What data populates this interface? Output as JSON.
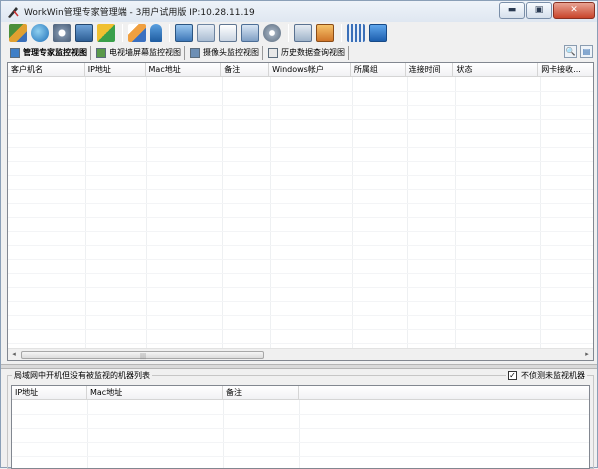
{
  "window": {
    "title": "WorkWin管理专家管理端 - 3用户试用版 IP:10.28.11.19",
    "controls": {
      "minimize": "▬",
      "maximize": "▣",
      "close": "✕"
    }
  },
  "toolbar": {
    "icons": [
      "books-icon",
      "globe-icon",
      "settings-gear-icon",
      "monitor-user-icon",
      "puzzle-icon",
      "edit-pencil-icon",
      "pin-icon",
      "computer-icon",
      "mail-icon",
      "document-edit-icon",
      "windows-icon",
      "disk-icon",
      "notepad-icon",
      "transfer-icon",
      "keyboard-icon",
      "info-icon"
    ]
  },
  "tabs": [
    {
      "label": "管理专家监控视图",
      "active": true
    },
    {
      "label": "电视墙屏幕监控视图",
      "active": false
    },
    {
      "label": "摄像头监控视图",
      "active": false
    },
    {
      "label": "历史数据查询视图",
      "active": false
    }
  ],
  "upper_table": {
    "columns": [
      "客户机名",
      "IP地址",
      "Mac地址",
      "备注",
      "Windows帐户",
      "所属组",
      "连接时间",
      "状态",
      "网卡接收..."
    ]
  },
  "scrollbar": {
    "left_arrow": "◂",
    "right_arrow": "▸",
    "grip": "|||"
  },
  "lower_panel": {
    "title": "局域网中开机但没有被监视的机器列表",
    "checkbox_label": "不侦测未监视机器",
    "checkbox_checked": true,
    "checkbox_mark": "✓",
    "columns": [
      "IP地址",
      "Mac地址",
      "备注"
    ]
  },
  "view_icons": {
    "search": "🔍",
    "list": "▤"
  }
}
